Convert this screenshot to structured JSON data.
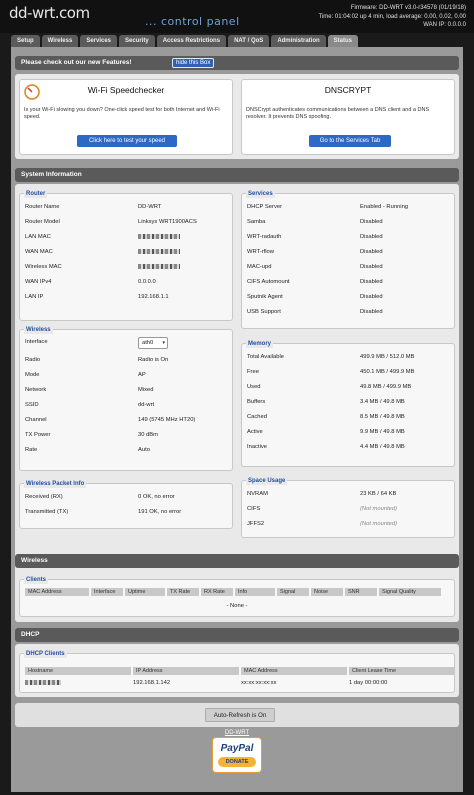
{
  "header": {
    "logo": "dd-wrt.com",
    "subtitle": "... control panel",
    "firmware": "Firmware: DD-WRT v3.0-r34578 (01/19/18)",
    "time": "Time: 01:04:02 up 4 min, load average: 0.00, 0.02, 0.00",
    "wan_ip": "WAN IP: 0.0.0.0"
  },
  "tabs": [
    "Setup",
    "Wireless",
    "Services",
    "Security",
    "Access Restrictions",
    "NAT / QoS",
    "Administration",
    "Status"
  ],
  "features": {
    "heading": "Please check out our new Features!",
    "hide_button": "hide this Box",
    "speed": {
      "title": "Wi-Fi Speedchecker",
      "text": "Is your Wi-Fi slowing you down? One-click speed test for both Internet and Wi-Fi speed.",
      "button": "Click here to test your speed"
    },
    "dnscrypt": {
      "title": "DNSCRYPT",
      "text": "DNSCrypt authenticates communications between a DNS client and a DNS resolver. It prevents DNS spoofing.",
      "button": "Go to the Services Tab"
    }
  },
  "system": {
    "heading": "System Information",
    "router": {
      "legend": "Router",
      "rows": [
        {
          "label": "Router Name",
          "value": "DD-WRT"
        },
        {
          "label": "Router Model",
          "value": "Linksys WRT1900ACS"
        },
        {
          "label": "LAN MAC",
          "value": ""
        },
        {
          "label": "WAN MAC",
          "value": ""
        },
        {
          "label": "Wireless MAC",
          "value": ""
        },
        {
          "label": "WAN IPv4",
          "value": "0.0.0.0"
        },
        {
          "label": "LAN IP",
          "value": "192.168.1.1"
        }
      ]
    },
    "services": {
      "legend": "Services",
      "rows": [
        {
          "label": "DHCP Server",
          "value": "Enabled - Running"
        },
        {
          "label": "Samba",
          "value": "Disabled"
        },
        {
          "label": "WRT-radauth",
          "value": "Disabled"
        },
        {
          "label": "WRT-rflow",
          "value": "Disabled"
        },
        {
          "label": "MAC-upd",
          "value": "Disabled"
        },
        {
          "label": "CIFS Automount",
          "value": "Disabled"
        },
        {
          "label": "Sputnik Agent",
          "value": "Disabled"
        },
        {
          "label": "USB Support",
          "value": "Disabled"
        }
      ]
    },
    "wireless": {
      "legend": "Wireless",
      "interface_label": "Interface",
      "interface_value": "ath0",
      "rows": [
        {
          "label": "Radio",
          "value": "Radio is On"
        },
        {
          "label": "Mode",
          "value": "AP"
        },
        {
          "label": "Network",
          "value": "Mixed"
        },
        {
          "label": "SSID",
          "value": "dd-wrt"
        },
        {
          "label": "Channel",
          "value": "149 (5745 MHz HT20)"
        },
        {
          "label": "TX Power",
          "value": "30 dBm"
        },
        {
          "label": "Rate",
          "value": "Auto"
        }
      ]
    },
    "memory": {
      "legend": "Memory",
      "rows": [
        {
          "label": "Total Available",
          "value": "499.9 MB / 512.0 MB",
          "fill": 0.976
        },
        {
          "label": "Free",
          "value": "450.1 MB / 499.9 MB",
          "fill": 0.9
        },
        {
          "label": "Used",
          "value": "49.8 MB / 499.9 MB",
          "fill": 0.1
        },
        {
          "label": "Buffers",
          "value": "3.4 MB / 49.8 MB",
          "fill": 0.068
        },
        {
          "label": "Cached",
          "value": "8.5 MB / 49.8 MB",
          "fill": 0.171
        },
        {
          "label": "Active",
          "value": "9.9 MB / 49.8 MB",
          "fill": 0.199
        },
        {
          "label": "Inactive",
          "value": "4.4 MB / 49.8 MB",
          "fill": 0.088
        }
      ]
    },
    "packet": {
      "legend": "Wireless Packet Info",
      "rows": [
        {
          "label": "Received (RX)",
          "value": "0 OK, no error"
        },
        {
          "label": "Transmitted (TX)",
          "value": "191 OK, no error"
        }
      ]
    },
    "space": {
      "legend": "Space Usage",
      "rows": [
        {
          "label": "NVRAM",
          "value": "23 KB / 64 KB",
          "fill": 0.36
        },
        {
          "label": "CIFS",
          "value": "(Not mounted)"
        },
        {
          "label": "JFFS2",
          "value": "(Not mounted)"
        }
      ]
    }
  },
  "wireless_section": {
    "heading": "Wireless",
    "clients_legend": "Clients",
    "columns": [
      "MAC Address",
      "Interface",
      "Uptime",
      "TX Rate",
      "RX Rate",
      "Info",
      "Signal",
      "Noise",
      "SNR",
      "Signal Quality"
    ],
    "empty": "- None -"
  },
  "dhcp": {
    "heading": "DHCP",
    "clients_legend": "DHCP Clients",
    "columns": [
      "Hostname",
      "IP Address",
      "MAC Address",
      "Client Lease Time"
    ],
    "rows": [
      {
        "hostname": "",
        "ip": "192.168.1.142",
        "mac": "xx:xx:xx:xx:xx",
        "lease": "1 day 00:00:00"
      }
    ]
  },
  "footer": {
    "autorefresh": "Auto-Refresh is On",
    "link": "DD-WRT",
    "paypal": "PayPal",
    "donate": "DONATE"
  },
  "colors": {
    "accent": "#2d68c6",
    "legend": "#2250a0",
    "bar": "#5a5a5a"
  }
}
